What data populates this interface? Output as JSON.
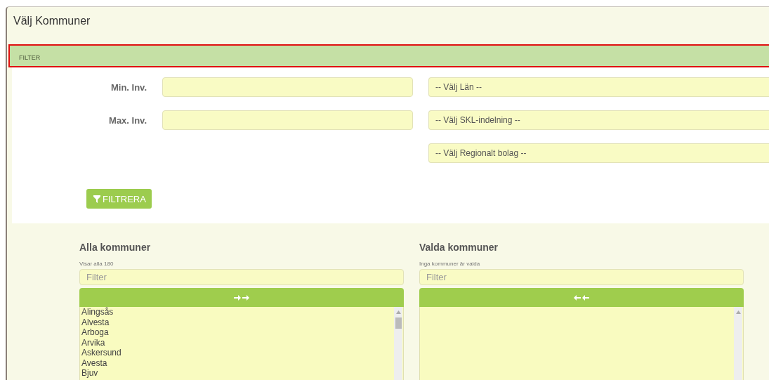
{
  "window": {
    "title": "Välj Kommuner"
  },
  "filter_bar": {
    "label": "FILTER",
    "highlighted": true
  },
  "filter": {
    "inputs": [
      {
        "label": "Min. Inv."
      },
      {
        "label": "Max. Inv."
      }
    ],
    "selects": [
      {
        "value": "-- Välj Län --"
      },
      {
        "value": "-- Välj SKL-indelning --"
      },
      {
        "value": "-- Välj Regionalt bolag --"
      }
    ],
    "button": {
      "label": "FILTRERA"
    }
  },
  "lists": [
    {
      "title": "Alla kommuner",
      "note": "Visar alla 180",
      "placeholder": "Filter",
      "kind": "source",
      "items": [
        {
          "label": "Alingsås",
          "selected": false
        },
        {
          "label": "Alvesta",
          "selected": false
        },
        {
          "label": "Arboga",
          "selected": false
        },
        {
          "label": "Arvika",
          "selected": false
        },
        {
          "label": "Askersund",
          "selected": false
        },
        {
          "label": "Avesta",
          "selected": false
        },
        {
          "label": "Bjuv",
          "selected": false
        }
      ]
    },
    {
      "title": "Valda kommuner",
      "note": "Inga kommuner är valda",
      "placeholder": "Filter",
      "kind": "target"
    }
  ]
}
